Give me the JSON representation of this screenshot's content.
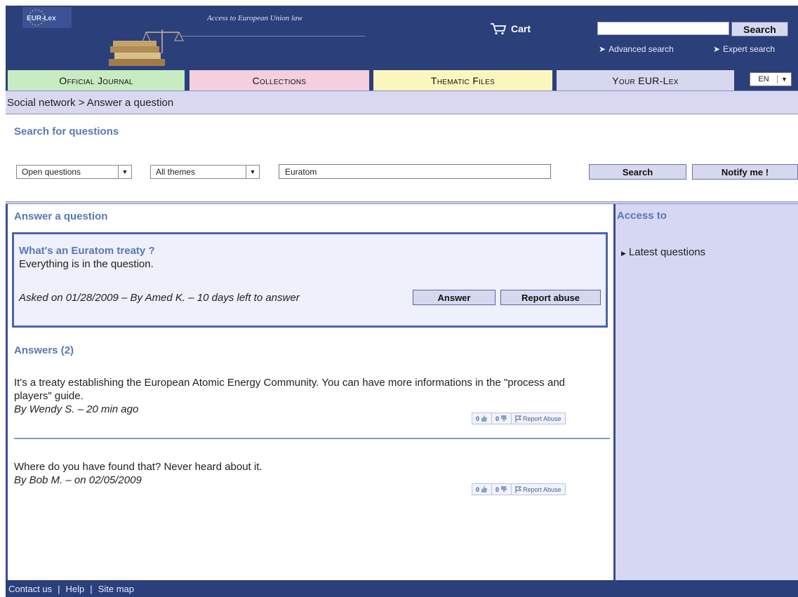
{
  "header": {
    "logo_text": "EUR-Lex",
    "tagline": "Access to European Union law",
    "cart_label": "Cart",
    "search_button": "Search",
    "advanced_search": "Advanced search",
    "expert_search": "Expert search"
  },
  "nav": {
    "tabs": [
      {
        "label": "Official Journal",
        "color": "#c9ebc2"
      },
      {
        "label": "Collections",
        "color": "#f3cfe0"
      },
      {
        "label": "Thematic Files",
        "color": "#fbf6bd"
      },
      {
        "label": "Your EUR-Lex",
        "color": "#d7d7ef"
      }
    ],
    "language": "EN"
  },
  "breadcrumb": "Social network > Answer a question",
  "search": {
    "title": "Search for questions",
    "status_select": "Open questions",
    "theme_select": "All themes",
    "query": "Euratom",
    "search_button": "Search",
    "notify_button": "Notify me !"
  },
  "question": {
    "section_title": "Answer a question",
    "title": "What's an Euratom treaty ?",
    "body": "Everything is in the question.",
    "meta": "Asked on 01/28/2009 – By Amed K. – 10 days left to answer",
    "answer_button": "Answer",
    "report_button": "Report abuse"
  },
  "answers": {
    "title": "Answers (2)",
    "items": [
      {
        "text": "It's a treaty establishing the European Atomic Energy Community. You can have more informations in the \"process and players\" guide.",
        "by": "By Wendy S. – 20 min ago",
        "likes": "0",
        "dislikes": "0",
        "report": "Report Abuse"
      },
      {
        "text": "Where do you have found that? Never heard about it.",
        "by": "By Bob M. – on 02/05/2009",
        "likes": "0",
        "dislikes": "0",
        "report": "Report Abuse"
      }
    ]
  },
  "sidebar": {
    "title": "Access to",
    "link": "Latest questions"
  },
  "footer": {
    "contact": "Contact us",
    "help": "Help",
    "sitemap": "Site map"
  },
  "colors": {
    "header_bg": "#2b3f7a",
    "accent_title": "#5a78b2",
    "panel_bg": "#d6d7f3"
  }
}
